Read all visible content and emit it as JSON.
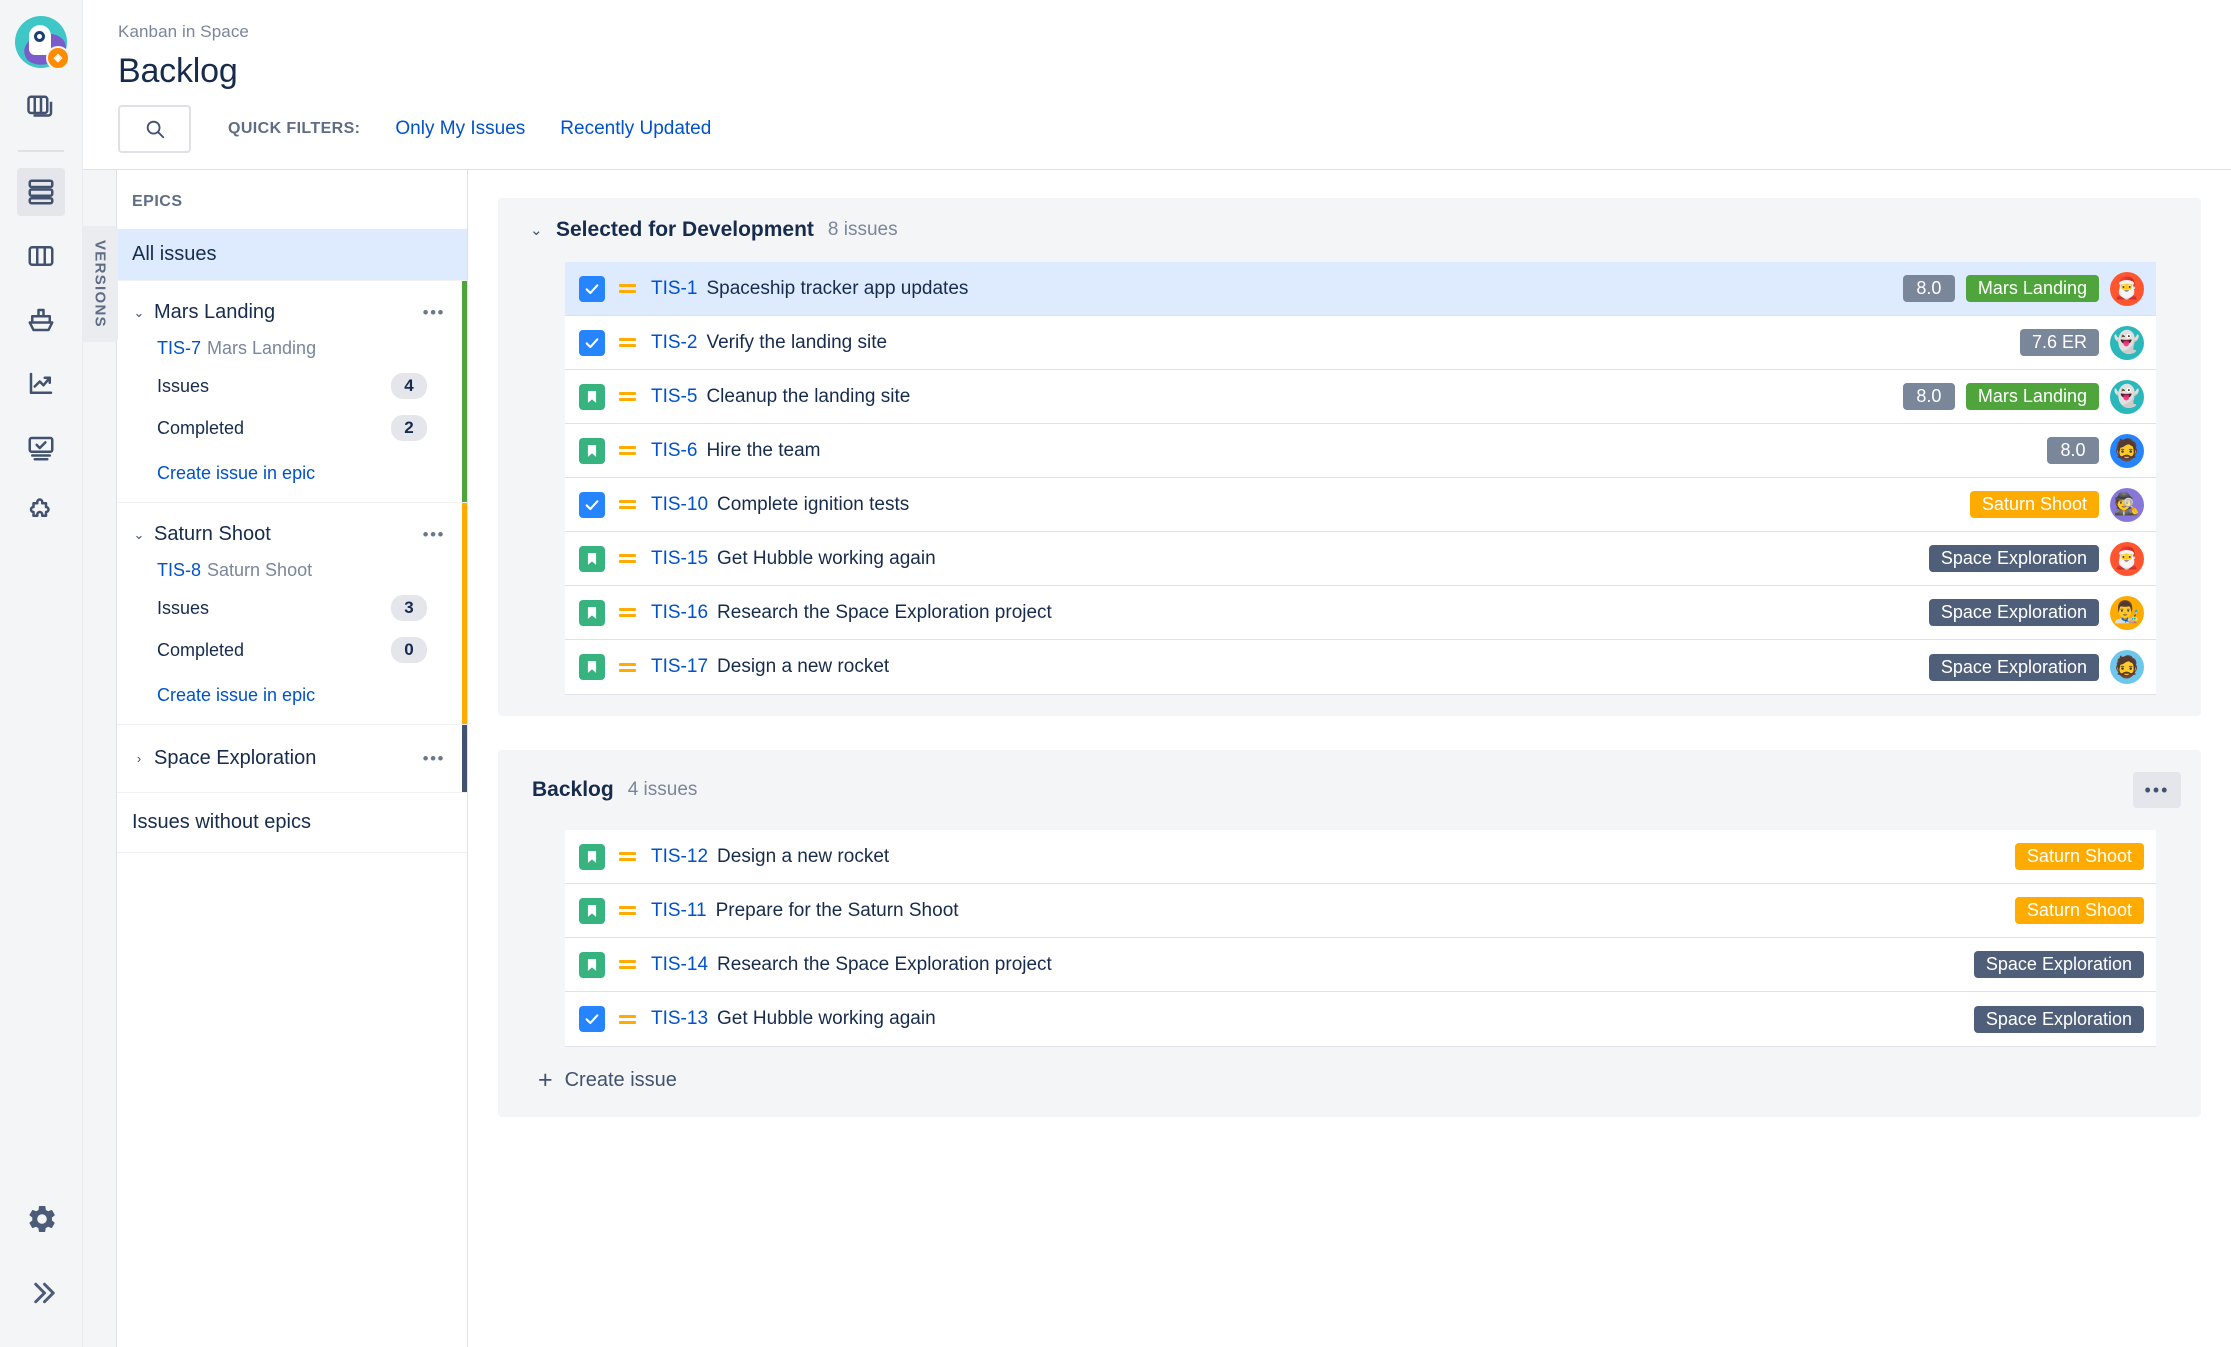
{
  "rail": {
    "logo_name": "project-avatar-rocket",
    "items": [
      {
        "name": "boards-icon",
        "label": "Boards"
      },
      {
        "name": "backlog-icon",
        "label": "Backlog",
        "active": true
      },
      {
        "name": "kanban-board-icon",
        "label": "Board"
      },
      {
        "name": "releases-ship-icon",
        "label": "Releases"
      },
      {
        "name": "reports-chart-icon",
        "label": "Reports"
      },
      {
        "name": "issues-monitor-icon",
        "label": "Issues"
      },
      {
        "name": "add-item-puzzle-icon",
        "label": "Add item"
      }
    ],
    "bottom_items": [
      {
        "name": "project-settings-gear-icon",
        "label": "Project settings"
      },
      {
        "name": "expand-sidebar-icon",
        "label": "Expand"
      }
    ]
  },
  "header": {
    "breadcrumb": "Kanban in Space",
    "title": "Backlog",
    "search_placeholder": "Search",
    "search_value": "",
    "quick_filters_label": "QUICK FILTERS:",
    "quick_filters": [
      {
        "label": "Only My Issues"
      },
      {
        "label": "Recently Updated"
      }
    ]
  },
  "versions_tab": {
    "label": "VERSIONS"
  },
  "epics_panel": {
    "heading": "EPICS",
    "all_issues": "All issues",
    "issues_without_epics": "Issues without epics",
    "labels": {
      "issues": "Issues",
      "completed": "Completed",
      "create_issue_in_epic": "Create issue in epic",
      "more": "•••"
    },
    "epics": [
      {
        "name": "Mars Landing",
        "key": "TIS-7",
        "key_name": "Mars Landing",
        "issues": "4",
        "completed": "2",
        "color": "#4FA53C",
        "expanded": true,
        "chevron": "⌄"
      },
      {
        "name": "Saturn Shoot",
        "key": "TIS-8",
        "key_name": "Saturn Shoot",
        "issues": "3",
        "completed": "0",
        "color": "#FFAB00",
        "expanded": true,
        "chevron": "⌄"
      },
      {
        "name": "Space Exploration",
        "key": "",
        "key_name": "",
        "issues": "",
        "completed": "",
        "color": "#42526E",
        "expanded": false,
        "chevron": "›"
      }
    ]
  },
  "sections": [
    {
      "id": "selected",
      "title": "Selected for Development",
      "count": "8 issues",
      "chevron": "⌄",
      "has_more_button": false,
      "issues": [
        {
          "type": "task",
          "type_icon": "task-checkbox-icon",
          "priority_icon": "priority-medium-icon",
          "key": "TIS-1",
          "summary": "Spaceship tracker app updates",
          "estimate": "8.0",
          "epic": "Mars Landing",
          "epic_color": "#4FA53C",
          "avatar": "🎅",
          "avatar_bg": "#FF5630",
          "selected": true
        },
        {
          "type": "task",
          "type_icon": "task-checkbox-icon",
          "priority_icon": "priority-medium-icon",
          "key": "TIS-2",
          "summary": "Verify the landing site",
          "estimate": "7.6 ER",
          "epic": "",
          "epic_color": "",
          "avatar": "👻",
          "avatar_bg": "#2BB8BA",
          "selected": false
        },
        {
          "type": "story",
          "type_icon": "story-bookmark-icon",
          "priority_icon": "priority-medium-icon",
          "key": "TIS-5",
          "summary": "Cleanup the landing site",
          "estimate": "8.0",
          "epic": "Mars Landing",
          "epic_color": "#4FA53C",
          "avatar": "👻",
          "avatar_bg": "#2BB8BA",
          "selected": false
        },
        {
          "type": "story",
          "type_icon": "story-bookmark-icon",
          "priority_icon": "priority-medium-icon",
          "key": "TIS-6",
          "summary": "Hire the team",
          "estimate": "8.0",
          "epic": "",
          "epic_color": "",
          "avatar": "🧔",
          "avatar_bg": "#2684FF",
          "selected": false
        },
        {
          "type": "task",
          "type_icon": "task-checkbox-icon",
          "priority_icon": "priority-medium-icon",
          "key": "TIS-10",
          "summary": "Complete ignition tests",
          "estimate": "",
          "epic": "Saturn Shoot",
          "epic_color": "#FFAB00",
          "avatar": "🕵️",
          "avatar_bg": "#8777D9",
          "selected": false
        },
        {
          "type": "story",
          "type_icon": "story-bookmark-icon",
          "priority_icon": "priority-medium-icon",
          "key": "TIS-15",
          "summary": "Get Hubble working again",
          "estimate": "",
          "epic": "Space Exploration",
          "epic_color": "#505F79",
          "avatar": "🎅",
          "avatar_bg": "#FF5630",
          "selected": false
        },
        {
          "type": "story",
          "type_icon": "story-bookmark-icon",
          "priority_icon": "priority-medium-icon",
          "key": "TIS-16",
          "summary": "Research the Space Exploration project",
          "estimate": "",
          "epic": "Space Exploration",
          "epic_color": "#505F79",
          "avatar": "👨‍🎨",
          "avatar_bg": "#FFAB00",
          "selected": false
        },
        {
          "type": "story",
          "type_icon": "story-bookmark-icon",
          "priority_icon": "priority-medium-icon",
          "key": "TIS-17",
          "summary": "Design a new rocket",
          "estimate": "",
          "epic": "Space Exploration",
          "epic_color": "#505F79",
          "avatar": "🧔",
          "avatar_bg": "#6DC7EC",
          "selected": false
        }
      ]
    },
    {
      "id": "backlog",
      "title": "Backlog",
      "count": "4 issues",
      "chevron": "",
      "has_more_button": true,
      "more_label": "•••",
      "create_issue_label": "Create issue",
      "create_issue_plus": "+",
      "issues": [
        {
          "type": "story",
          "type_icon": "story-bookmark-icon",
          "priority_icon": "priority-medium-icon",
          "key": "TIS-12",
          "summary": "Design a new rocket",
          "estimate": "",
          "epic": "Saturn Shoot",
          "epic_color": "#FFAB00",
          "avatar": "",
          "avatar_bg": "",
          "selected": false
        },
        {
          "type": "story",
          "type_icon": "story-bookmark-icon",
          "priority_icon": "priority-medium-icon",
          "key": "TIS-11",
          "summary": "Prepare for the Saturn Shoot",
          "estimate": "",
          "epic": "Saturn Shoot",
          "epic_color": "#FFAB00",
          "avatar": "",
          "avatar_bg": "",
          "selected": false
        },
        {
          "type": "story",
          "type_icon": "story-bookmark-icon",
          "priority_icon": "priority-medium-icon",
          "key": "TIS-14",
          "summary": "Research the Space Exploration project",
          "estimate": "",
          "epic": "Space Exploration",
          "epic_color": "#505F79",
          "avatar": "",
          "avatar_bg": "",
          "selected": false
        },
        {
          "type": "task",
          "type_icon": "task-checkbox-icon",
          "priority_icon": "priority-medium-icon",
          "key": "TIS-13",
          "summary": "Get Hubble working again",
          "estimate": "",
          "epic": "Space Exploration",
          "epic_color": "#505F79",
          "avatar": "",
          "avatar_bg": "",
          "selected": false
        }
      ]
    }
  ],
  "colors": {
    "link": "#0052CC",
    "selected_row": "#DEEBFF",
    "epic_green": "#4FA53C",
    "epic_orange": "#FFAB00",
    "epic_dark": "#505F79",
    "estimate_gray": "#7A869A",
    "task_blue": "#2684FF",
    "story_green": "#36B37E",
    "priority_orange": "#FFAB00"
  }
}
